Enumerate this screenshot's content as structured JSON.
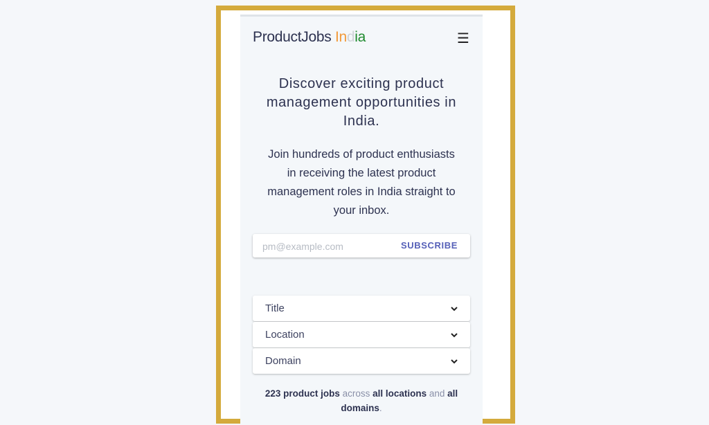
{
  "header": {
    "brand": "ProductJobs",
    "country_letters": [
      "In",
      "d",
      "ia"
    ],
    "menu_icon": "hamburger-icon"
  },
  "hero": {
    "headline": "Discover exciting product management opportunities in India.",
    "subline": "Join hundreds of product enthusiasts in receiving the latest product management roles in India straight to your inbox."
  },
  "subscribe": {
    "placeholder": "pm@example.com",
    "button_label": "SUBSCRIBE"
  },
  "filters": [
    {
      "label": "Title",
      "icon": "chevron-down-icon"
    },
    {
      "label": "Location",
      "icon": "chevron-down-icon"
    },
    {
      "label": "Domain",
      "icon": "chevron-down-icon"
    }
  ],
  "summary": {
    "count_text": "223 product jobs",
    "across": " across ",
    "locations": "all locations",
    "and": " and ",
    "domains": "all domains",
    "period": "."
  },
  "colors": {
    "accent": "#5660b8",
    "india_saffron": "#f29a3a",
    "india_white": "#cfd3d8",
    "india_green": "#1e8a2e",
    "frame_gold": "#d4aa3c"
  }
}
